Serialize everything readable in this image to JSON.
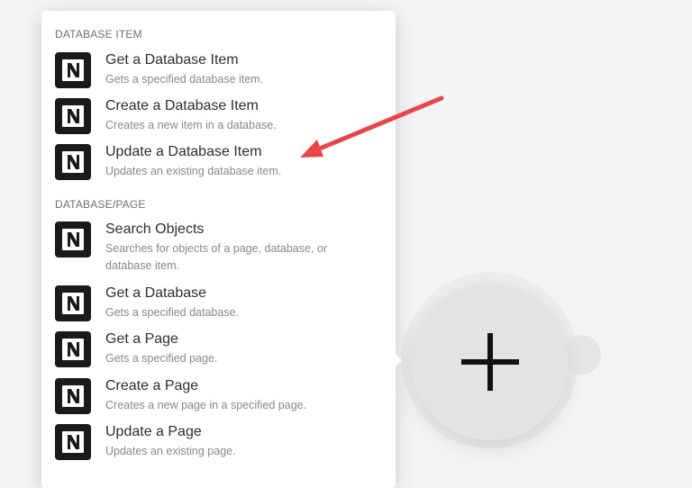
{
  "sections": [
    {
      "header": "DATABASE ITEM",
      "items": [
        {
          "title": "Get a Database Item",
          "desc": "Gets a specified database item."
        },
        {
          "title": "Create a Database Item",
          "desc": "Creates a new item in a database."
        },
        {
          "title": "Update a Database Item",
          "desc": "Updates an existing database item."
        }
      ]
    },
    {
      "header": "DATABASE/PAGE",
      "items": [
        {
          "title": "Search Objects",
          "desc": "Searches for objects of a page, database, or database item."
        },
        {
          "title": "Get a Database",
          "desc": "Gets a specified database."
        },
        {
          "title": "Get a Page",
          "desc": "Gets a specified page."
        },
        {
          "title": "Create a Page",
          "desc": "Creates a new page in a specified page."
        },
        {
          "title": "Update a Page",
          "desc": "Updates an existing page."
        }
      ]
    }
  ],
  "icons": {
    "module_icon": "notion-logo-icon",
    "add_button_icon": "plus-icon",
    "annotation": "red-arrow-icon"
  },
  "colors": {
    "icon_bg": "#1a1a1a",
    "arrow": "#e8454a",
    "panel": "#ffffff",
    "add_circle": "#e3e3e3"
  }
}
